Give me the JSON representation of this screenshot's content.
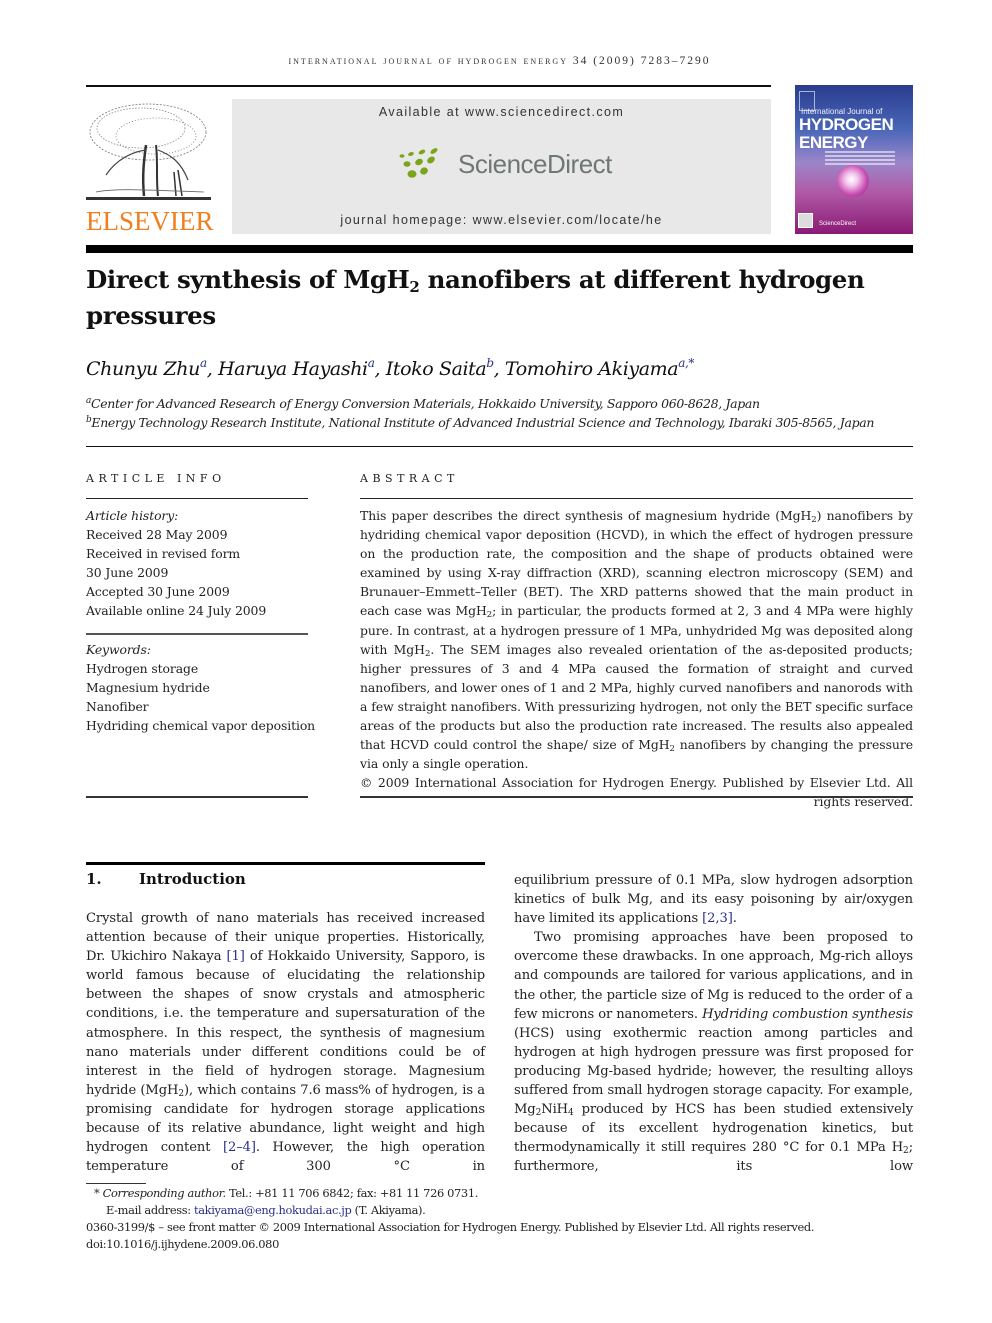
{
  "header": {
    "journal_line": "INTERNATIONAL JOURNAL OF HYDROGEN ENERGY 34 (2009) 7283–7290",
    "publisher_logo_text": "ELSEVIER",
    "available_at": "Available at www.sciencedirect.com",
    "sciencedirect_logo_text": "ScienceDirect",
    "journal_homepage": "journal homepage: www.elsevier.com/locate/he",
    "cover": {
      "intl_line": "International Journal of",
      "title_line1": "HYDROGEN",
      "title_line2": "ENERGY",
      "bottom_text": "ScienceDirect"
    },
    "colors": {
      "elsevier_orange": "#f07f1f",
      "sciencedirect_green": "#7aa51a",
      "sciencedirect_gray": "#6f7773",
      "link_blue": "#2a2f8a"
    }
  },
  "article": {
    "title_part1": "Direct synthesis of MgH",
    "title_sub": "2",
    "title_part2": " nanofibers at different hydrogen pressures",
    "authors": [
      {
        "name": "Chunyu Zhu",
        "affil": "a"
      },
      {
        "name": "Haruya Hayashi",
        "affil": "a"
      },
      {
        "name": "Itoko Saita",
        "affil": "b"
      },
      {
        "name": "Tomohiro Akiyama",
        "affil": "a,*"
      }
    ],
    "affiliations": [
      {
        "key": "a",
        "text": "Center for Advanced Research of Energy Conversion Materials, Hokkaido University, Sapporo 060-8628, Japan"
      },
      {
        "key": "b",
        "text": "Energy Technology Research Institute, National Institute of Advanced Industrial Science and Technology, Ibaraki 305-8565, Japan"
      }
    ]
  },
  "article_info": {
    "label": "ARTICLE INFO",
    "history_label": "Article history:",
    "history": [
      "Received 28 May 2009",
      "Received in revised form",
      "30 June 2009",
      "Accepted 30 June 2009",
      "Available online 24 July 2009"
    ],
    "keywords_label": "Keywords:",
    "keywords": [
      "Hydrogen storage",
      "Magnesium hydride",
      "Nanofiber",
      "Hydriding chemical vapor deposition"
    ]
  },
  "abstract": {
    "label": "ABSTRACT",
    "p1": "This paper describes the direct synthesis of magnesium hydride (MgH",
    "p2": ") nanofibers by hydriding chemical vapor deposition (HCVD), in which the effect of hydrogen pressure on the production rate, the composition and the shape of products obtained were examined by using X-ray diffraction (XRD), scanning electron microscopy (SEM) and Brunauer–Emmett–Teller (BET). The XRD patterns showed that the main product in each case was MgH",
    "p3": "; in particular, the products formed at 2, 3 and 4 MPa were highly pure. In contrast, at a hydrogen pressure of 1 MPa, unhydrided Mg was deposited along with MgH",
    "p4": ". The SEM images also revealed orientation of the as-deposited products; higher pressures of 3 and 4 MPa caused the formation of straight and curved nanofibers, and lower ones of 1 and 2 MPa, highly curved nanofibers and nanorods with a few straight nanofibers. With pressurizing hydrogen, not only the BET specific surface areas of the products but also the production rate increased. The results also appealed that HCVD could control the shape/ size of MgH",
    "p5": " nanofibers by changing the pressure via only a single operation.",
    "sub": "2",
    "copyright": "© 2009 International Association for Hydrogen Energy. Published by Elsevier Ltd. All rights reserved."
  },
  "intro": {
    "number": "1.",
    "heading": "Introduction",
    "left": {
      "a": "Crystal growth of nano materials has received increased attention because of their unique properties. Historically, Dr. Ukichiro Nakaya ",
      "ref1": "[1]",
      "b": " of Hokkaido University, Sapporo, is world famous because of elucidating the relationship between the shapes of snow crystals and atmospheric conditions, i.e. the temperature and supersaturation of the atmosphere. In this respect, the synthesis of magnesium nano materials under different conditions could be of interest in the field of hydrogen storage. Magnesium hydride (MgH",
      "sub": "2",
      "c": "), which contains 7.6 mass% of hydrogen, is a promising candidate for hydrogen storage applications because of its relative abundance, light weight and high hydrogen content ",
      "ref2": "[2–4]",
      "d": ". However, the high operation temperature of 300 °C in"
    },
    "right": {
      "a": "equilibrium pressure of 0.1 MPa, slow hydrogen adsorption kinetics of bulk Mg, and its easy poisoning by air/oxygen have limited its applications ",
      "ref": "[2,3]",
      "b": ".",
      "p2a": "Two promising approaches have been proposed to overcome these drawbacks. In one approach, Mg-rich alloys and compounds are tailored for various applications, and in the other, the particle size of Mg is reduced to the order of a few microns or nanometers. ",
      "p2_italic": "Hydriding combustion synthesis",
      "p2b": " (HCS) using exothermic reaction among particles and hydrogen at high hydrogen pressure was first proposed for producing Mg-based hydride; however, the resulting alloys suffered from small hydrogen storage capacity. For example, Mg",
      "sub_a": "2",
      "p2c": "NiH",
      "sub_b": "4",
      "p2d": " produced by HCS has been studied extensively because of its excellent hydrogenation kinetics, but thermodynamically it still requires 280 °C for 0.1 MPa H",
      "sub_c": "2",
      "p2e": "; furthermore, its low"
    }
  },
  "footnotes": {
    "star": "*",
    "corresponding_label": "Corresponding author.",
    "contact": " Tel.: +81 11 706 6842; fax: +81 11 726 0731.",
    "email_label": "E-mail address: ",
    "email": "takiyama@eng.hokudai.ac.jp",
    "email_name": " (T. Akiyama).",
    "front_matter": "0360-3199/$ – see front matter © 2009 International Association for Hydrogen Energy. Published by Elsevier Ltd. All rights reserved.",
    "doi": "doi:10.1016/j.ijhydene.2009.06.080"
  }
}
